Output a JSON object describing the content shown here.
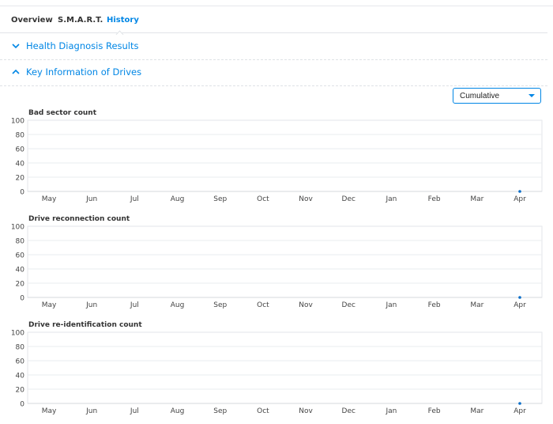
{
  "tabs": [
    {
      "label": "Overview"
    },
    {
      "label": "S.M.A.R.T."
    },
    {
      "label": "History"
    }
  ],
  "sections": {
    "health": {
      "label": "Health Diagnosis Results"
    },
    "key_info": {
      "label": "Key Information of Drives"
    }
  },
  "dropdown": {
    "value": "Cumulative"
  },
  "colors": {
    "accent": "#0086e5",
    "grid": "#e9ecef",
    "point": "#0a6ec8"
  },
  "chart_data": [
    {
      "type": "line",
      "title": "Bad sector count",
      "categories": [
        "May",
        "Jun",
        "Jul",
        "Aug",
        "Sep",
        "Oct",
        "Nov",
        "Dec",
        "Jan",
        "Feb",
        "Mar",
        "Apr"
      ],
      "yticks": [
        "100",
        "80",
        "60",
        "40",
        "20",
        "0"
      ],
      "ylim": [
        0,
        100
      ],
      "series": [
        {
          "values": [
            null,
            null,
            null,
            null,
            null,
            null,
            null,
            null,
            null,
            null,
            null,
            0
          ]
        }
      ],
      "grid": true
    },
    {
      "type": "line",
      "title": "Drive reconnection count",
      "categories": [
        "May",
        "Jun",
        "Jul",
        "Aug",
        "Sep",
        "Oct",
        "Nov",
        "Dec",
        "Jan",
        "Feb",
        "Mar",
        "Apr"
      ],
      "yticks": [
        "100",
        "80",
        "60",
        "40",
        "20",
        "0"
      ],
      "ylim": [
        0,
        100
      ],
      "series": [
        {
          "values": [
            null,
            null,
            null,
            null,
            null,
            null,
            null,
            null,
            null,
            null,
            null,
            0
          ]
        }
      ],
      "grid": true
    },
    {
      "type": "line",
      "title": "Drive re-identification count",
      "categories": [
        "May",
        "Jun",
        "Jul",
        "Aug",
        "Sep",
        "Oct",
        "Nov",
        "Dec",
        "Jan",
        "Feb",
        "Mar",
        "Apr"
      ],
      "yticks": [
        "100",
        "80",
        "60",
        "40",
        "20",
        "0"
      ],
      "ylim": [
        0,
        100
      ],
      "series": [
        {
          "values": [
            null,
            null,
            null,
            null,
            null,
            null,
            null,
            null,
            null,
            null,
            null,
            0
          ]
        }
      ],
      "grid": true
    }
  ]
}
